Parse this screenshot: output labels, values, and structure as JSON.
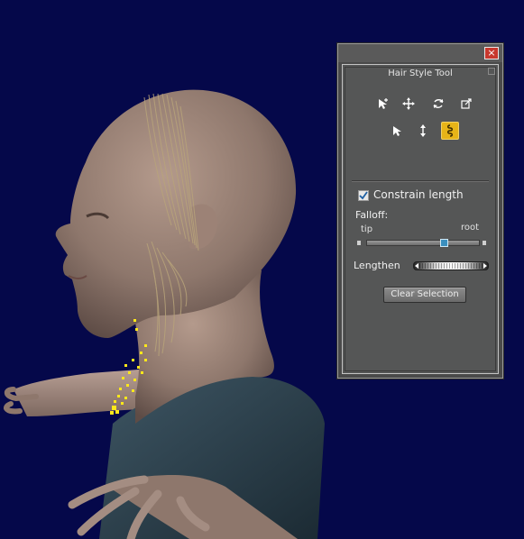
{
  "viewport": {
    "background_color": "#05084a"
  },
  "window": {
    "close_glyph": "×",
    "panel_title": "Hair Style Tool"
  },
  "tools": {
    "row1": [
      {
        "name": "select-add-icon"
      },
      {
        "name": "move-icon"
      },
      {
        "name": "rotate-icon"
      },
      {
        "name": "scale-icon"
      }
    ],
    "row2": [
      {
        "name": "select-arrow-icon"
      },
      {
        "name": "vertical-move-icon"
      },
      {
        "name": "length-tool-icon",
        "active": true
      }
    ],
    "active_color": "#e7b418"
  },
  "options": {
    "constrain_length_label": "Constrain length",
    "constrain_length_checked": true,
    "falloff_label": "Falloff:",
    "tip_label": "tip",
    "root_label": "root",
    "falloff_value": 0.7,
    "lengthen_label": "Lengthen",
    "clear_selection_label": "Clear Selection"
  }
}
